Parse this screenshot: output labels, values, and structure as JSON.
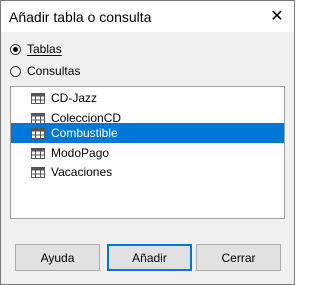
{
  "window": {
    "title": "Añadir tabla o consulta",
    "close_glyph": "✕"
  },
  "options": {
    "tables_label": "Tablas",
    "queries_label": "Consultas",
    "selected": "tables"
  },
  "list": {
    "items": [
      {
        "label": "CD-Jazz",
        "selected": false
      },
      {
        "label": "ColeccionCD",
        "selected": false
      },
      {
        "label": "Combustible",
        "selected": true
      },
      {
        "label": "ModoPago",
        "selected": false
      },
      {
        "label": "Vacaciones",
        "selected": false
      }
    ]
  },
  "buttons": {
    "help_label": "Ayuda",
    "add_label": "Añadir",
    "close_label": "Cerrar"
  },
  "colors": {
    "selection": "#0078d7",
    "default_button_border": "#0078d7"
  }
}
